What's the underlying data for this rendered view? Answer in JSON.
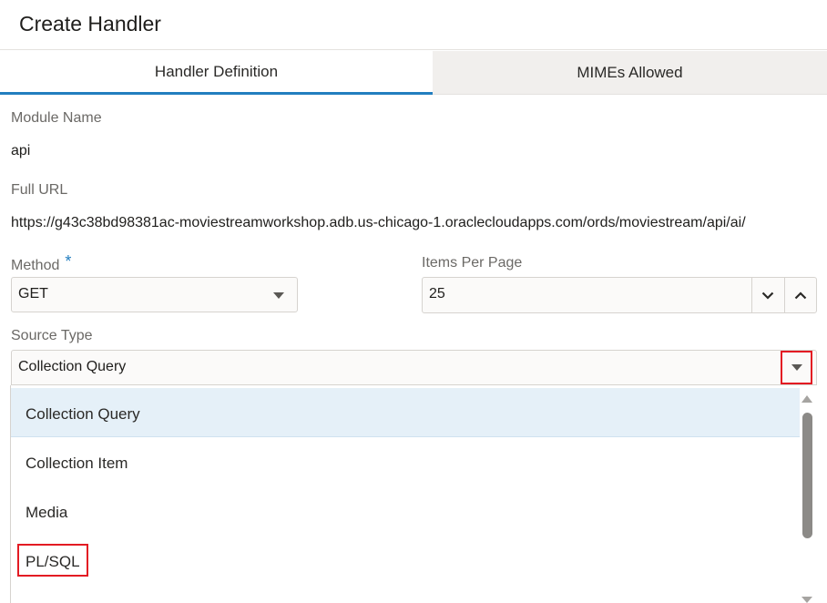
{
  "dialog": {
    "title": "Create Handler"
  },
  "tabs": [
    {
      "label": "Handler Definition",
      "active": true
    },
    {
      "label": "MIMEs Allowed",
      "active": false
    }
  ],
  "form": {
    "module_name": {
      "label": "Module Name",
      "value": "api"
    },
    "full_url": {
      "label": "Full URL",
      "value": "https://g43c38bd98381ac-moviestreamworkshop.adb.us-chicago-1.oraclecloudapps.com/ords/moviestream/api/ai/"
    },
    "method": {
      "label": "Method",
      "required_mark": "*",
      "value": "GET"
    },
    "items_per_page": {
      "label": "Items Per Page",
      "value": "25"
    },
    "source_type": {
      "label": "Source Type",
      "value": "Collection Query",
      "options": [
        "Collection Query",
        "Collection Item",
        "Media",
        "PL/SQL"
      ],
      "highlighted_index": 0
    }
  },
  "colors": {
    "accent": "#227ebf",
    "annotation_red": "#e31b23",
    "selected_option_bg": "#e5f0f8"
  },
  "icons": {
    "method_dropdown": "caret-down-icon",
    "stepper_down": "chevron-down-icon",
    "stepper_up": "chevron-up-icon",
    "source_dropdown": "caret-down-icon"
  }
}
